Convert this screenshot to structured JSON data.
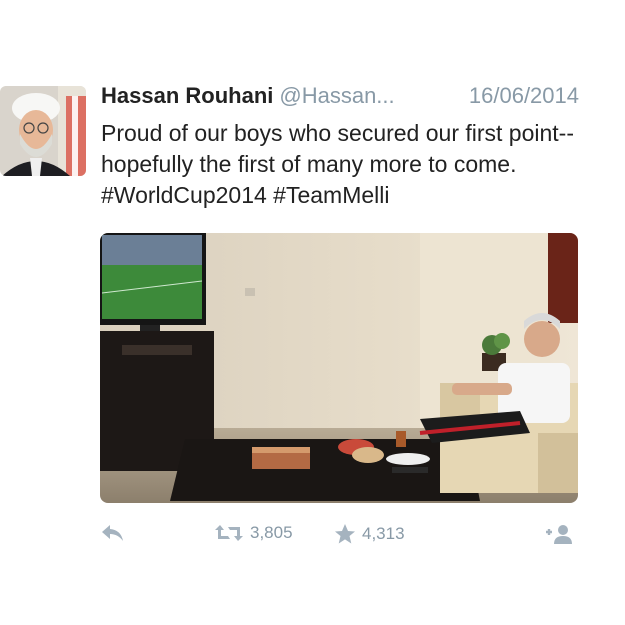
{
  "tweet": {
    "author_name": "Hassan Rouhani",
    "handle": "@Hassan...",
    "date": "16/06/2014",
    "text": "Proud of our boys who secured our first point--hopefully the first of many more to come. #WorldCup2014 #TeamMelli",
    "retweets": "3,805",
    "favorites": "4,313"
  },
  "icons": {
    "reply": "reply-icon",
    "retweet": "retweet-icon",
    "favorite": "star-icon",
    "follow": "follow-icon"
  },
  "colors": {
    "name": "#222222",
    "meta": "#8899a6",
    "action": "#a5b3bf"
  }
}
